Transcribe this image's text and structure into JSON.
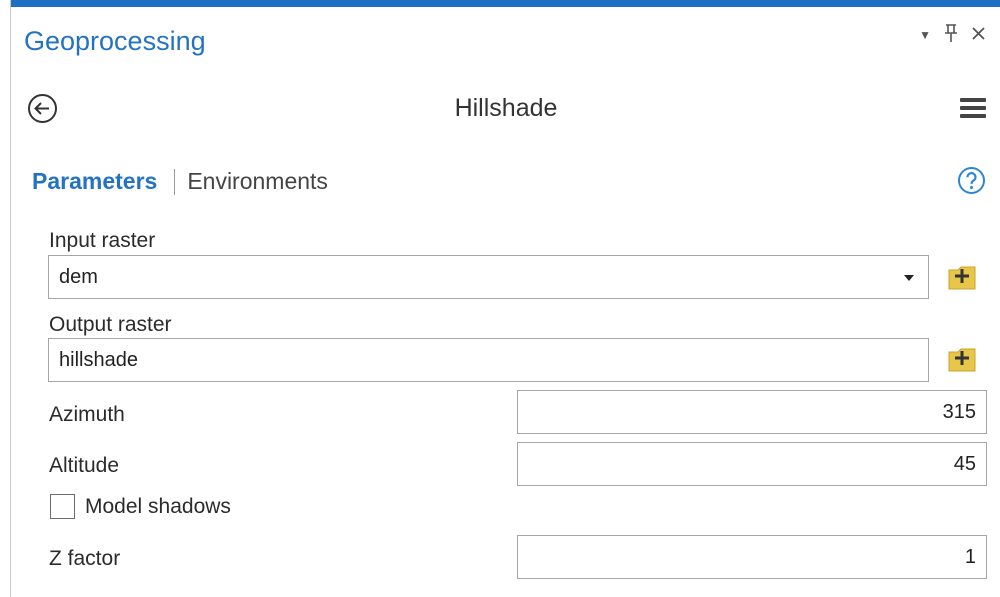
{
  "pane": {
    "title": "Geoprocessing"
  },
  "window_controls": {
    "dropdown": "▾",
    "pin": "📌",
    "close": "✕"
  },
  "tool": {
    "name": "Hillshade"
  },
  "tabs": {
    "parameters": "Parameters",
    "environments": "Environments"
  },
  "icons": {
    "back": "back-arrow-icon",
    "menu": "hamburger-menu-icon",
    "help": "help-icon",
    "browse": "folder-add-icon",
    "dropdown": "chevron-down-icon"
  },
  "params": {
    "input_raster": {
      "label": "Input raster",
      "value": "dem"
    },
    "output_raster": {
      "label": "Output raster",
      "value": "hillshade"
    },
    "azimuth": {
      "label": "Azimuth",
      "value": "315"
    },
    "altitude": {
      "label": "Altitude",
      "value": "45"
    },
    "model_shadows": {
      "label": "Model shadows",
      "checked": false
    },
    "z_factor": {
      "label": "Z factor",
      "value": "1"
    }
  },
  "colors": {
    "accent": "#2473c2",
    "top_bar": "#1d6fc4",
    "folder": "#e8c64a"
  }
}
